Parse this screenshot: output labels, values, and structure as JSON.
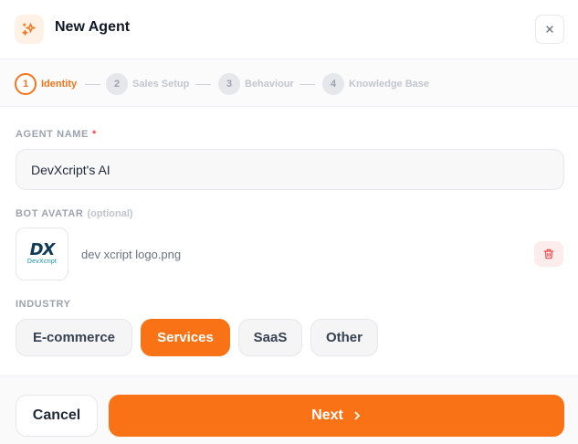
{
  "header": {
    "title": "New Agent",
    "icon": "sparkles-icon",
    "close_icon": "close-icon"
  },
  "stepper": {
    "steps": [
      {
        "number": "1",
        "label": "Identity",
        "state": "active"
      },
      {
        "number": "2",
        "label": "Sales Setup",
        "state": "inactive"
      },
      {
        "number": "3",
        "label": "Behaviour",
        "state": "inactive"
      },
      {
        "number": "4",
        "label": "Knowledge Base",
        "state": "inactive"
      }
    ]
  },
  "agent_name": {
    "label": "AGENT NAME",
    "required_mark": "*",
    "value": "DevXcript's AI"
  },
  "bot_avatar": {
    "label": "BOT AVATAR",
    "optional_text": "(optional)",
    "logo_mark": "DX",
    "logo_text": "DevXcript",
    "file_name": "dev xcript logo.png",
    "delete_icon": "trash-icon"
  },
  "industry": {
    "label": "INDUSTRY",
    "options": [
      "E-commerce",
      "Services",
      "SaaS",
      "Other"
    ],
    "selected": "Services"
  },
  "footer": {
    "cancel_label": "Cancel",
    "next_label": "Next"
  },
  "colors": {
    "accent": "#f97316",
    "accent_light": "#fff1e6",
    "danger": "#ef4444",
    "danger_light": "#fdecec"
  }
}
